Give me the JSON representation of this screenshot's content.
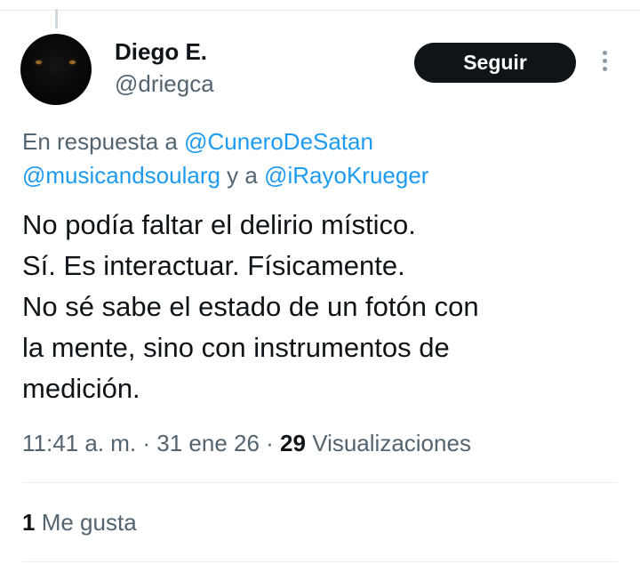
{
  "author": {
    "name": "Diego E.",
    "handle": "@driegca"
  },
  "follow_button": {
    "label": "Seguir"
  },
  "more_icon": "more-vertical-icon",
  "reply_context": {
    "prefix": "En respuesta a ",
    "mention_1": "@CuneroDeSatan",
    "mention_2": "@musicandsoularg",
    "connector": " y a ",
    "mention_3": "@iRayoKrueger"
  },
  "tweet": {
    "lines": [
      "No podía faltar el delirio místico.",
      "Sí. Es interactuar. Físicamente.",
      "No sé sabe el estado de un fotón con",
      "la mente, sino con instrumentos de",
      "medición."
    ]
  },
  "meta": {
    "time": "11:41 a. m.",
    "separator": " · ",
    "date": "31 ene 26",
    "views_count": "29",
    "views_label": "Visualizaciones"
  },
  "likes": {
    "count": "1",
    "label": "Me gusta"
  },
  "colors": {
    "link": "#1d9bf0",
    "secondary_text": "#536471",
    "primary_text": "#0f1419",
    "button_bg": "#0f1419"
  }
}
